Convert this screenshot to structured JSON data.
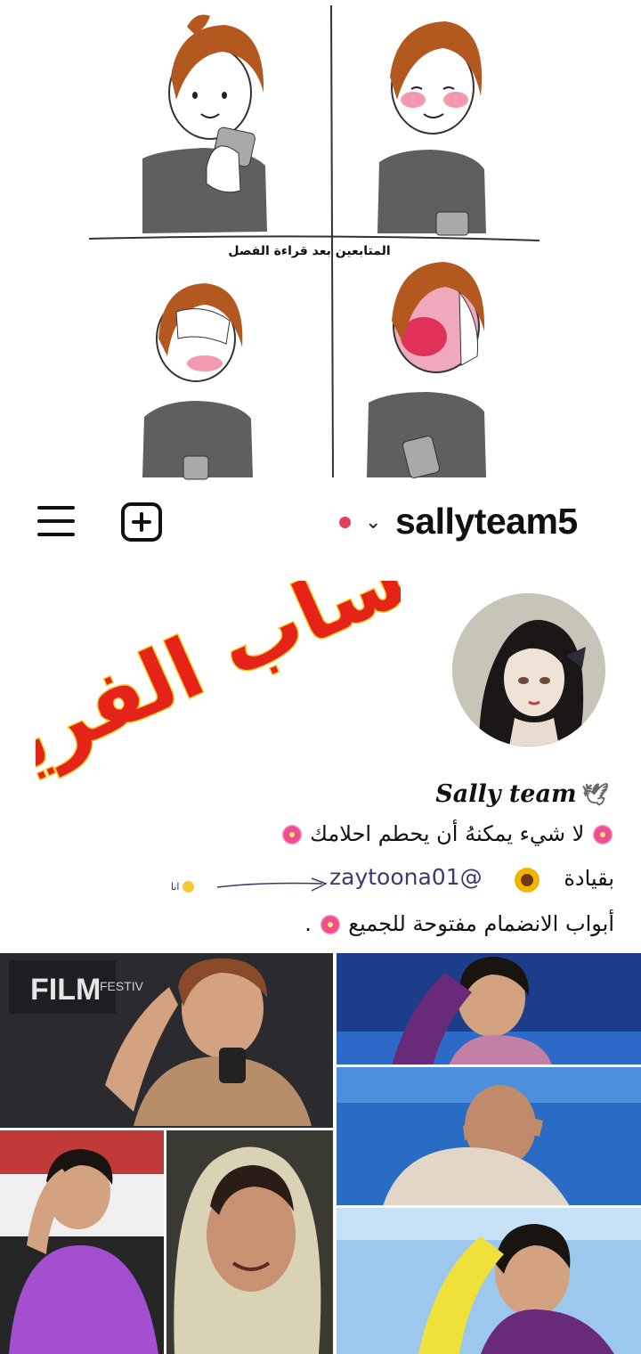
{
  "comic": {
    "caption": "المتابعين بعد قراءة الفصل"
  },
  "header": {
    "username": "sallyteam5",
    "menu_icon": "hamburger-menu-icon",
    "create_icon": "plus-square-icon",
    "switch_icon": "chevron-down-icon",
    "dot_color": "#e3405a"
  },
  "profile": {
    "graffiti_text": "حساب الفريق",
    "display_name": "Sally team",
    "bio_line_1": "لا شيء يمكنهُ أن يحطم احلامك",
    "lead_label": "بقيادة",
    "mention": "zaytoona01@",
    "me_label": "انا",
    "bio_line_3": "أبواب الانضمام مفتوحة للجميع",
    "bio_line_3_end": "."
  },
  "collage": {
    "banner_text": "FILM",
    "banner_small": "FESTIV"
  }
}
